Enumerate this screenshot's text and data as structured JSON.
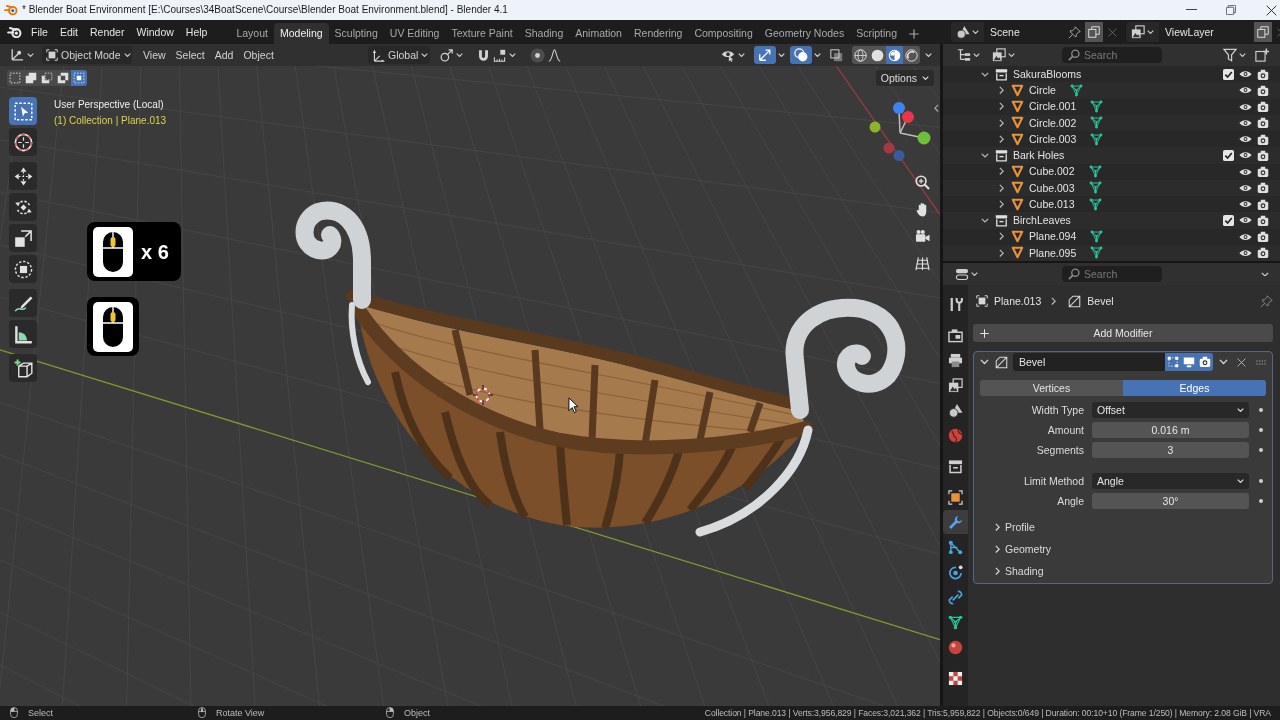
{
  "title_bar": {
    "title": "* Blender Boat Environment [E:\\Courses\\34BoatScene\\Course\\Blender Boat Environment.blend] - Blender 4.1"
  },
  "top_bar": {
    "menus": [
      "File",
      "Edit",
      "Render",
      "Window",
      "Help"
    ],
    "workspaces": [
      {
        "label": "Layout",
        "selected": false
      },
      {
        "label": "Modeling",
        "selected": true
      },
      {
        "label": "Sculpting",
        "selected": false
      },
      {
        "label": "UV Editing",
        "selected": false
      },
      {
        "label": "Texture Paint",
        "selected": false
      },
      {
        "label": "Shading",
        "selected": false
      },
      {
        "label": "Animation",
        "selected": false
      },
      {
        "label": "Rendering",
        "selected": false
      },
      {
        "label": "Compositing",
        "selected": false
      },
      {
        "label": "Geometry Nodes",
        "selected": false
      },
      {
        "label": "Scripting",
        "selected": false
      }
    ],
    "scene": "Scene",
    "view_layer": "ViewLayer"
  },
  "viewport": {
    "header": {
      "mode": "Object Mode",
      "menus": [
        "View",
        "Select",
        "Add",
        "Object"
      ],
      "orientation": "Global",
      "gizmos": true,
      "overlays": true,
      "xray": false,
      "shading_modes": [
        {
          "kind": "wireframe",
          "selected": false
        },
        {
          "kind": "solid",
          "selected": false
        },
        {
          "kind": "material",
          "selected": true
        },
        {
          "kind": "rendered",
          "selected": false
        }
      ],
      "select_modes": [
        {
          "kind": "set",
          "selected": false
        },
        {
          "kind": "extend",
          "selected": false
        },
        {
          "kind": "subtract",
          "selected": false
        },
        {
          "kind": "difference",
          "selected": false
        },
        {
          "kind": "intersect",
          "selected": true
        }
      ],
      "options": "Options"
    },
    "view_name": "User Perspective (Local)",
    "context": "(1) Collection | Plane.013",
    "tool_groups": [
      [
        {
          "kind": "select-box",
          "selected": true
        },
        {
          "kind": "cursor",
          "selected": false
        }
      ],
      [
        {
          "kind": "move",
          "selected": false
        },
        {
          "kind": "rotate",
          "selected": false
        },
        {
          "kind": "scale",
          "selected": false
        },
        {
          "kind": "transform",
          "selected": false
        }
      ],
      [
        {
          "kind": "annotate",
          "selected": false
        },
        {
          "kind": "measure",
          "selected": false
        }
      ],
      [
        {
          "kind": "add-cube",
          "selected": false
        }
      ]
    ],
    "key_overlays": [
      {
        "kind": "mouse-wheel",
        "count": "x 6"
      },
      {
        "kind": "mouse-wheel"
      }
    ]
  },
  "outliner": {
    "search_placeholder": "Search",
    "tree": [
      {
        "kind": "collection",
        "name": "SakuraBlooms",
        "expanded": true,
        "checked": true,
        "children": [
          {
            "kind": "object",
            "name": "Circle",
            "expanded": false
          },
          {
            "kind": "object",
            "name": "Circle.001",
            "expanded": false
          },
          {
            "kind": "object",
            "name": "Circle.002",
            "expanded": false
          },
          {
            "kind": "object",
            "name": "Circle.003",
            "expanded": false
          }
        ]
      },
      {
        "kind": "collection",
        "name": "Bark Holes",
        "expanded": true,
        "checked": true,
        "children": [
          {
            "kind": "object",
            "name": "Cube.002",
            "expanded": false
          },
          {
            "kind": "object",
            "name": "Cube.003",
            "expanded": false
          },
          {
            "kind": "object",
            "name": "Cube.013",
            "expanded": false
          }
        ]
      },
      {
        "kind": "collection",
        "name": "BirchLeaves",
        "expanded": true,
        "checked": true,
        "children": [
          {
            "kind": "object",
            "name": "Plane.094",
            "expanded": false
          },
          {
            "kind": "object",
            "name": "Plane.095",
            "expanded": false
          }
        ]
      }
    ]
  },
  "properties": {
    "search_placeholder": "Search",
    "tab_groups": [
      [
        {
          "kind": "tool",
          "selected": false
        }
      ],
      [
        {
          "kind": "render",
          "selected": false
        },
        {
          "kind": "output",
          "selected": false
        },
        {
          "kind": "view-layer",
          "selected": false
        },
        {
          "kind": "scene",
          "selected": false
        },
        {
          "kind": "world",
          "selected": false
        }
      ],
      [
        {
          "kind": "collection",
          "selected": false
        }
      ],
      [
        {
          "kind": "object",
          "selected": false
        },
        {
          "kind": "modifiers",
          "selected": true
        },
        {
          "kind": "particles",
          "selected": false
        },
        {
          "kind": "physics",
          "selected": false
        },
        {
          "kind": "constraints",
          "selected": false
        },
        {
          "kind": "data",
          "selected": false
        },
        {
          "kind": "material",
          "selected": false
        }
      ],
      [
        {
          "kind": "texture",
          "selected": false
        }
      ]
    ],
    "breadcrumb": [
      {
        "kind": "object",
        "label": "Plane.013"
      },
      {
        "kind": "modifier",
        "label": "Bevel"
      }
    ],
    "add_modifier": "Add Modifier",
    "modifier": {
      "name": "Bevel",
      "expanded": true,
      "edit_mode": true,
      "show_viewport": true,
      "show_render": true,
      "affect": [
        {
          "label": "Vertices",
          "selected": false
        },
        {
          "label": "Edges",
          "selected": true
        }
      ],
      "field_groups": [
        [
          {
            "kind": "dropdown",
            "label": "Width Type",
            "value": "Offset"
          },
          {
            "kind": "number",
            "label": "Amount",
            "value": "0.016 m"
          },
          {
            "kind": "number",
            "label": "Segments",
            "value": "3"
          }
        ],
        [
          {
            "kind": "dropdown",
            "label": "Limit Method",
            "value": "Angle"
          },
          {
            "kind": "number",
            "label": "Angle",
            "value": "30°"
          }
        ]
      ],
      "subpanels": [
        {
          "label": "Profile",
          "expanded": false
        },
        {
          "label": "Geometry",
          "expanded": false
        },
        {
          "label": "Shading",
          "expanded": false
        }
      ]
    }
  },
  "status_bar": {
    "hints": [
      {
        "kind": "mouse-left",
        "label": "Select"
      },
      {
        "kind": "mouse-middle",
        "label": "Rotate View"
      },
      {
        "kind": "mouse-right",
        "label": "Object"
      }
    ],
    "stats": "Collection | Plane.013 | Verts:3,956,829 | Faces:3,021,362 | Tris:5,959,822 | Objects:0/649 | Duration: 00:10+10 (Frame 1/250) | Memory: 2.08 GiB | VRA"
  }
}
